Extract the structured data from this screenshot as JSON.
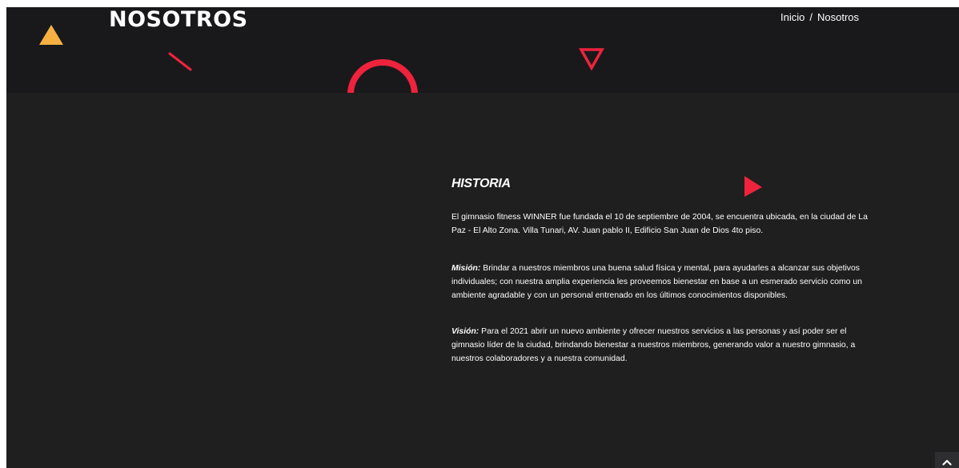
{
  "header": {
    "title": "NOSOTROS",
    "breadcrumb": {
      "home": "Inicio",
      "separator": "/",
      "current": "Nosotros"
    }
  },
  "decorations": {
    "colors": {
      "yellow_triangle": "#f5b041",
      "accent_red": "#ef233c"
    },
    "icons": [
      "triangle-up-icon",
      "slash-icon",
      "triangle-down-outline-icon",
      "half-ring-icon",
      "triangle-right-icon"
    ]
  },
  "historia": {
    "heading": "HISTORIA",
    "text": "El gimnasio fitness WINNER fue fundada el 10 de septiembre de 2004, se encuentra ubicada, en la ciudad de La Paz - El Alto Zona. Villa Tunari, AV. Juan pablo II, Edificio San Juan de Dios 4to piso."
  },
  "mision": {
    "label": "Misión:",
    "text": " Brindar a nuestros miembros una buena salud física y mental, para ayudarles a alcanzar sus objetivos individuales; con nuestra amplia experiencia les proveemos bienestar en base a un esmerado servicio como un ambiente agradable y con un personal entrenado en los últimos conocimientos disponibles."
  },
  "vision": {
    "label": "Visión:",
    "text": "  Para el 2021 abrir un nuevo ambiente y ofrecer nuestros servicios a las personas y así poder ser el gimnasio líder de la ciudad, brindando bienestar a nuestros miembros, generando valor a nuestro gimnasio, a nuestros colaboradores y a nuestra comunidad."
  },
  "scroll_top": {
    "icon": "chevron-up-icon"
  },
  "theme": {
    "background": "#1f1f1f",
    "hero_background": "#19191c",
    "text": "#ffffff"
  }
}
